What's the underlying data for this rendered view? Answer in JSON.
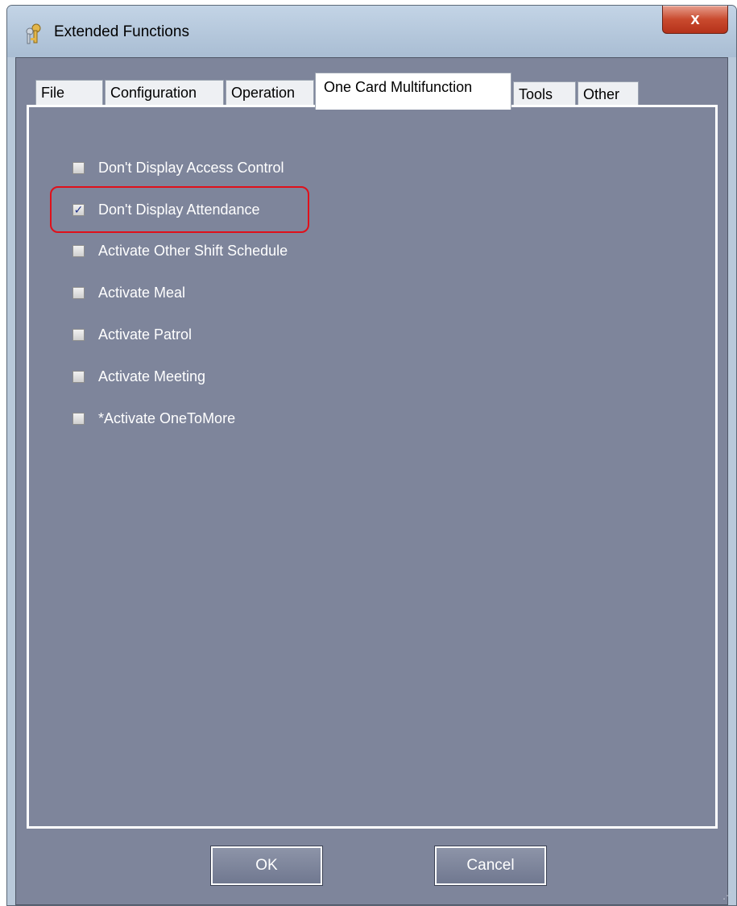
{
  "window": {
    "title": "Extended Functions",
    "close_label": "x"
  },
  "tabs": [
    {
      "label": "File",
      "active": false
    },
    {
      "label": "Configuration",
      "active": false
    },
    {
      "label": "Operation",
      "active": false
    },
    {
      "label": "One Card Multifunction",
      "active": true
    },
    {
      "label": "Tools",
      "active": false
    },
    {
      "label": "Other",
      "active": false
    }
  ],
  "options": [
    {
      "label": "Don't Display Access Control",
      "checked": false
    },
    {
      "label": "Don't Display Attendance",
      "checked": true,
      "highlighted": true
    },
    {
      "label": "Activate Other Shift Schedule",
      "checked": false
    },
    {
      "label": "Activate Meal",
      "checked": false
    },
    {
      "label": "Activate Patrol",
      "checked": false
    },
    {
      "label": "Activate Meeting",
      "checked": false
    },
    {
      "label": "*Activate OneToMore",
      "checked": false
    }
  ],
  "buttons": {
    "ok": "OK",
    "cancel": "Cancel"
  },
  "colors": {
    "panel_bg": "#7e859b",
    "highlight": "#e0101a",
    "close_button": "#c94a2e"
  }
}
